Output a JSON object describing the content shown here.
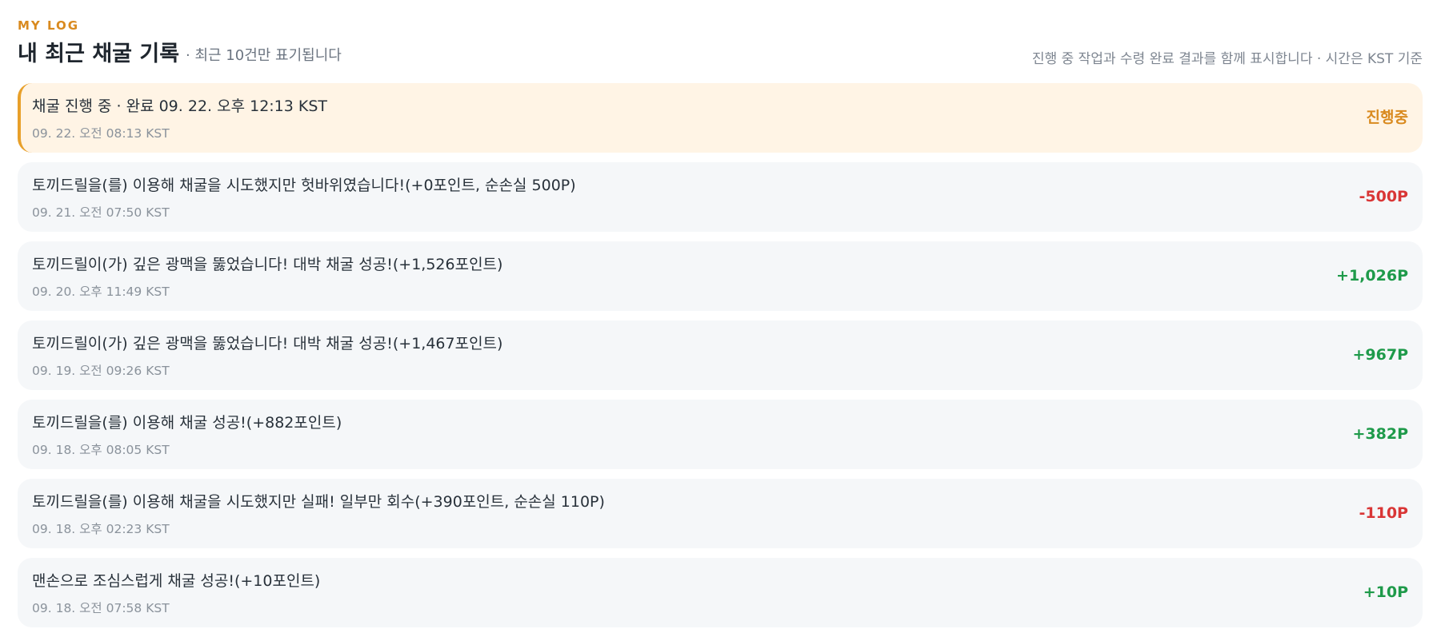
{
  "header": {
    "eyebrow": "MY LOG",
    "title": "내 최근 채굴 기록",
    "subtitle": "· 최근 10건만 표기됩니다",
    "right_note": "진행 중 작업과 수령 완료 결과를 함께 표시합니다 · 시간은 KST 기준"
  },
  "colors": {
    "accent": "#d98a1f",
    "active_bg": "#fff4e5",
    "active_border": "#e8a02a",
    "negative": "#d93636",
    "positive": "#1e9a4a",
    "pending": "#d98a1f"
  },
  "logs": [
    {
      "text": "채굴 진행 중 · 완료 09. 22. 오후 12:13 KST",
      "time": "09. 22. 오전 08:13 KST",
      "amount": "진행중",
      "status": "pending"
    },
    {
      "text": "토끼드릴을(를) 이용해 채굴을 시도했지만 헛바위였습니다!(+0포인트, 순손실 500P)",
      "time": "09. 21. 오전 07:50 KST",
      "amount": "-500P",
      "status": "negative"
    },
    {
      "text": "토끼드릴이(가) 깊은 광맥을 뚫었습니다! 대박 채굴 성공!(+1,526포인트)",
      "time": "09. 20. 오후 11:49 KST",
      "amount": "+1,026P",
      "status": "positive"
    },
    {
      "text": "토끼드릴이(가) 깊은 광맥을 뚫었습니다! 대박 채굴 성공!(+1,467포인트)",
      "time": "09. 19. 오전 09:26 KST",
      "amount": "+967P",
      "status": "positive"
    },
    {
      "text": "토끼드릴을(를) 이용해 채굴 성공!(+882포인트)",
      "time": "09. 18. 오후 08:05 KST",
      "amount": "+382P",
      "status": "positive"
    },
    {
      "text": "토끼드릴을(를) 이용해 채굴을 시도했지만 실패! 일부만 회수(+390포인트, 순손실 110P)",
      "time": "09. 18. 오후 02:23 KST",
      "amount": "-110P",
      "status": "negative"
    },
    {
      "text": "맨손으로 조심스럽게 채굴 성공!(+10포인트)",
      "time": "09. 18. 오전 07:58 KST",
      "amount": "+10P",
      "status": "positive"
    }
  ]
}
